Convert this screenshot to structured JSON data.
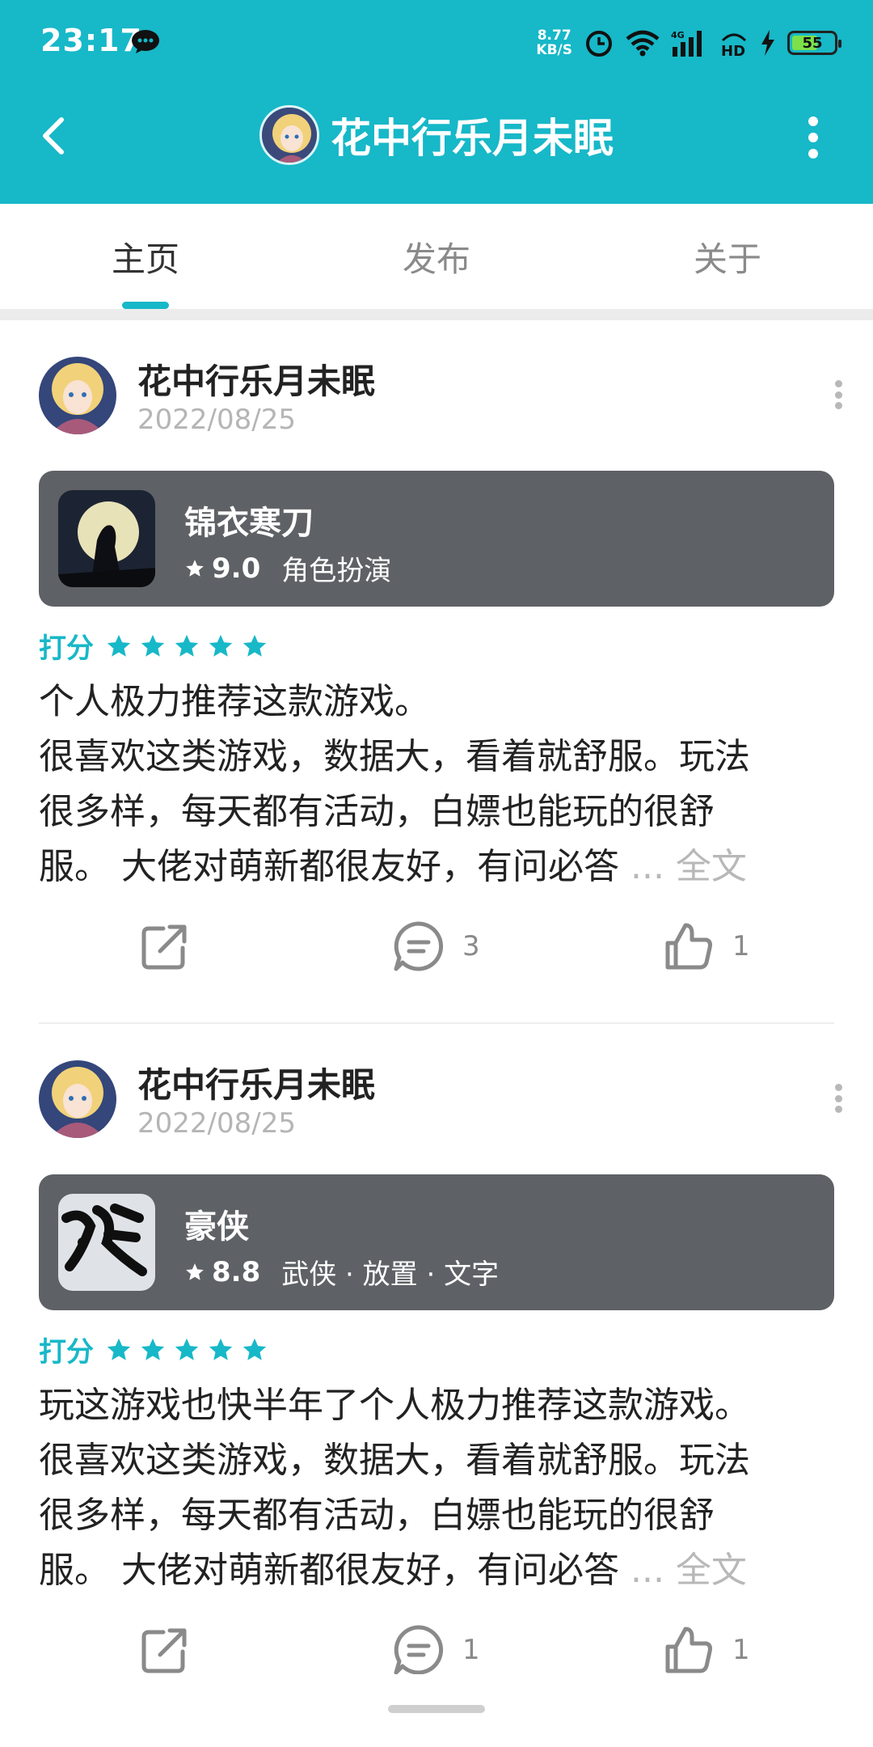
{
  "status_bar": {
    "time": "23:17",
    "net_speed_value": "8.77",
    "net_speed_unit": "KB/S",
    "battery": "55"
  },
  "header": {
    "title": "花中行乐月未眠"
  },
  "tabs": [
    {
      "label": "主页",
      "active": true
    },
    {
      "label": "发布",
      "active": false
    },
    {
      "label": "关于",
      "active": false
    }
  ],
  "colors": {
    "accent": "#17b8c8",
    "card_bg": "#5e6165"
  },
  "posts": [
    {
      "username": "花中行乐月未眠",
      "date": "2022/08/25",
      "game": {
        "name": "锦衣寒刀",
        "score": "9.0",
        "tags": "角色扮演"
      },
      "rating_label": "打分",
      "stars": 5,
      "text_lines": [
        "个人极力推荐这款游戏。",
        "很喜欢这类游戏，数据大，看着就舒服。玩法",
        "很多样，每天都有活动，白嫖也能玩的很舒",
        "服。 大佬对萌新都很友好，有问必答 "
      ],
      "more_text": "... 全文",
      "comments": "3",
      "likes": "1"
    },
    {
      "username": "花中行乐月未眠",
      "date": "2022/08/25",
      "game": {
        "name": "豪侠",
        "score": "8.8",
        "tags": "武侠 · 放置 · 文字"
      },
      "rating_label": "打分",
      "stars": 5,
      "text_lines": [
        "玩这游戏也快半年了个人极力推荐这款游戏。",
        "很喜欢这类游戏，数据大，看着就舒服。玩法",
        "很多样，每天都有活动，白嫖也能玩的很舒",
        "服。 大佬对萌新都很友好，有问必答 "
      ],
      "more_text": "... 全文",
      "comments": "1",
      "likes": "1"
    }
  ]
}
